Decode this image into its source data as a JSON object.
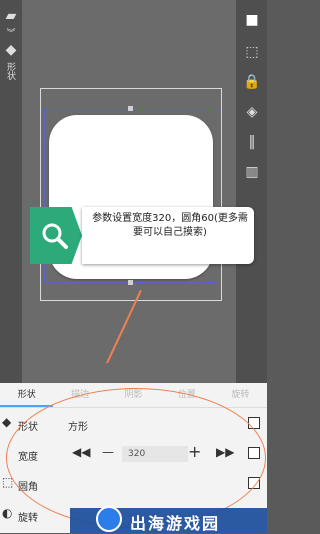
{
  "left_toolbar": {
    "shape_label": "形状"
  },
  "callout": {
    "text": "参数设置宽度320，圆角60(更多需要可以自己摸索)"
  },
  "tabs": [
    "形状",
    "描边",
    "阴影",
    "位置",
    "旋转"
  ],
  "active_tab": 0,
  "rows": {
    "shape": {
      "label": "形状",
      "value": "方形"
    },
    "width": {
      "label": "宽度",
      "value": "320"
    },
    "corner": {
      "label": "圆角"
    },
    "rotate": {
      "label": "旋转"
    }
  },
  "watermark": {
    "text": "出海游戏园"
  }
}
